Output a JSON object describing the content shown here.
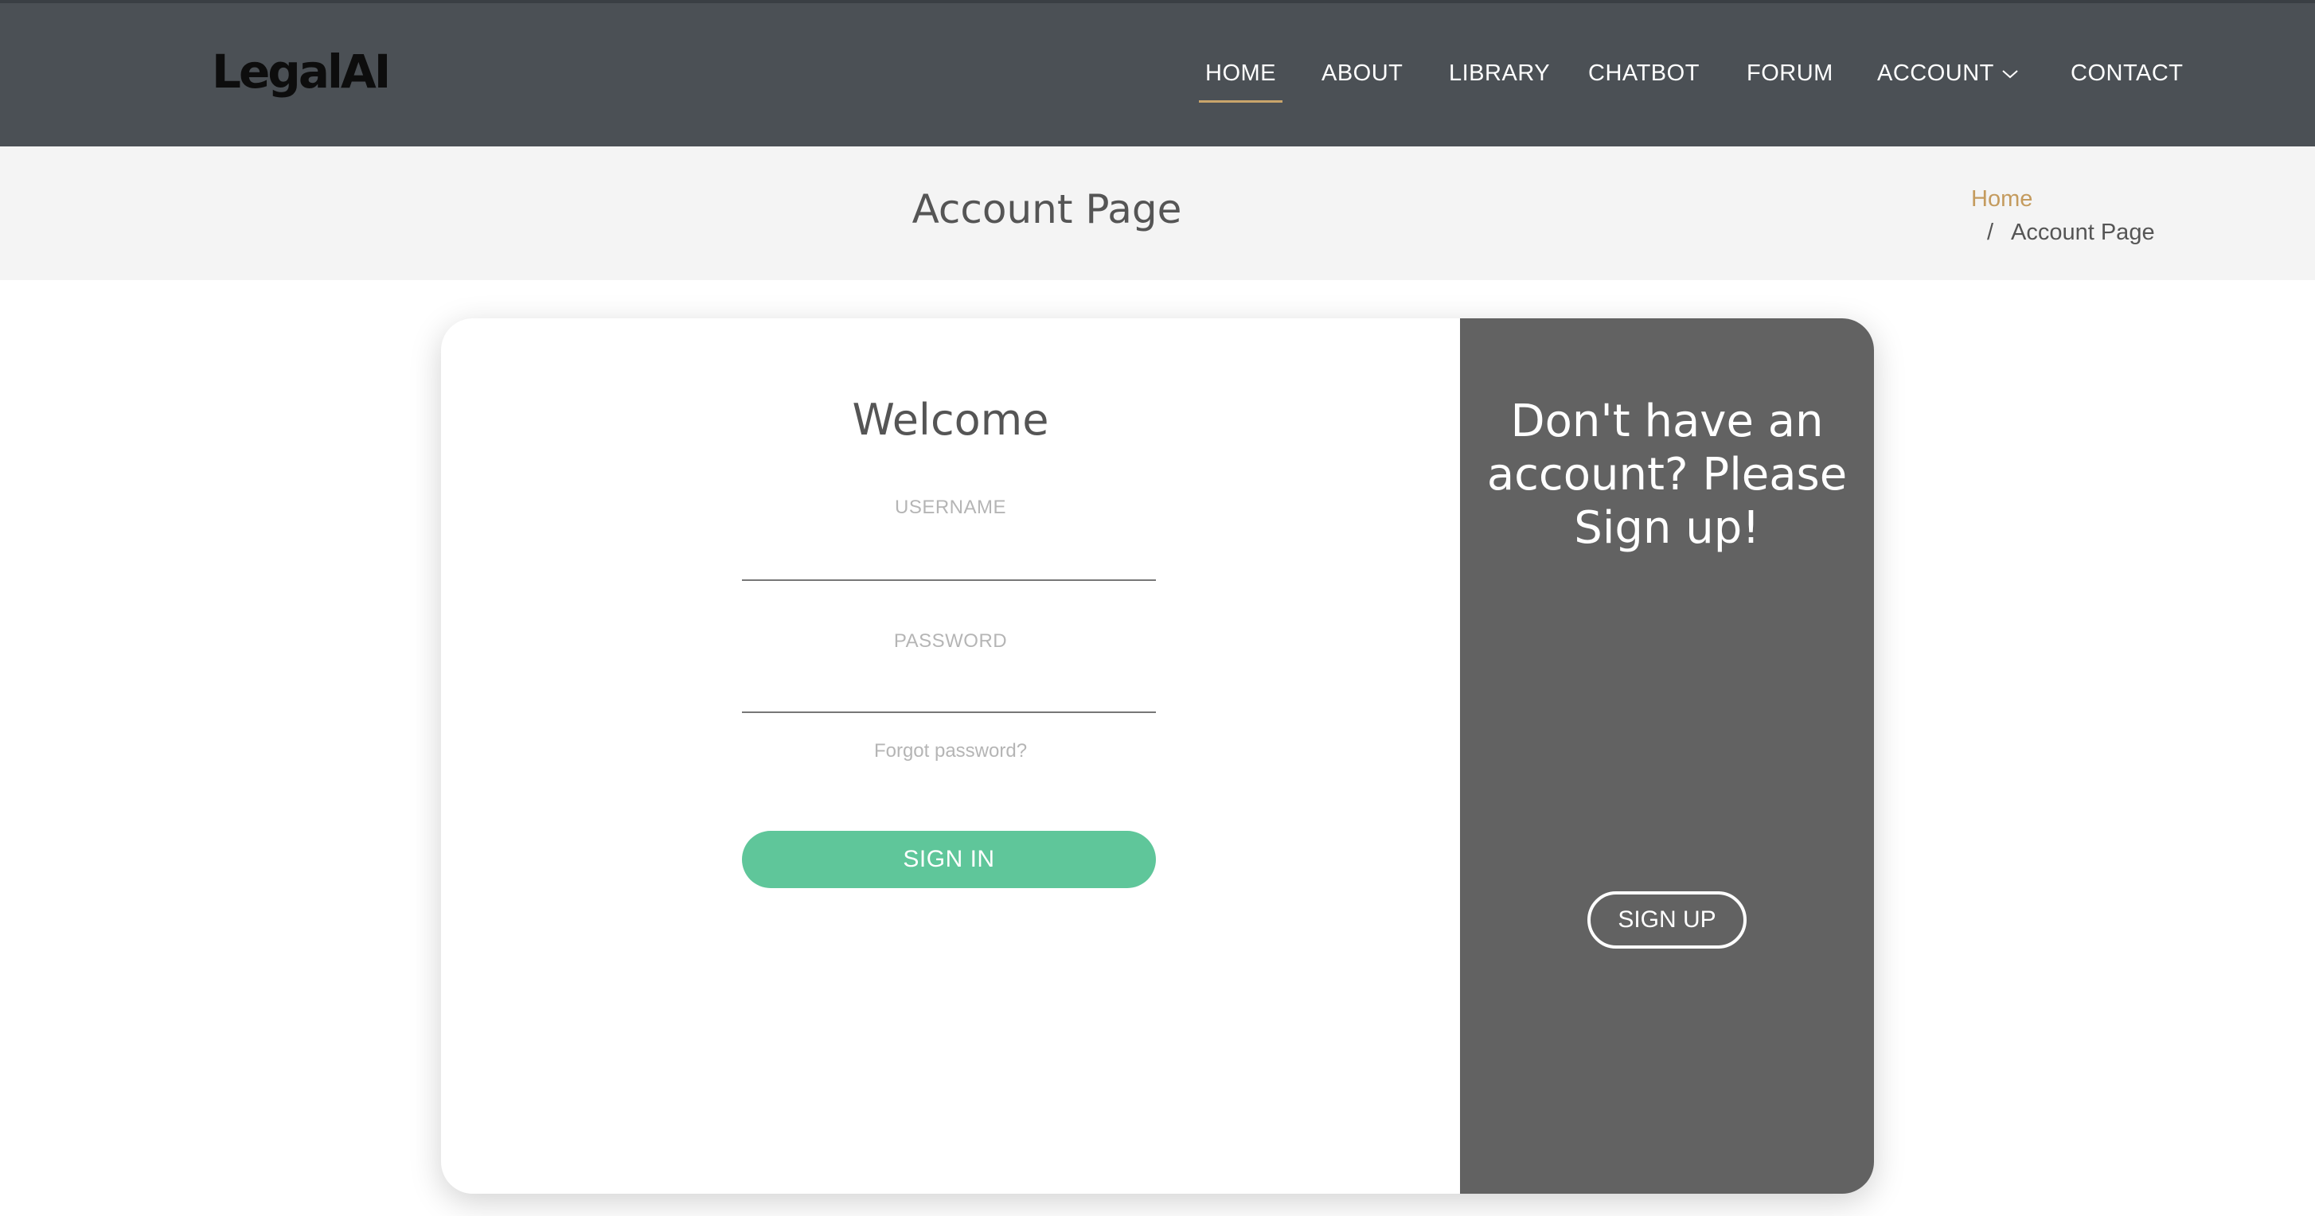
{
  "header": {
    "logo": "LegalAI",
    "nav": [
      {
        "label": "HOME",
        "active": true
      },
      {
        "label": "ABOUT",
        "active": false
      },
      {
        "label": "LIBRARY",
        "active": false
      },
      {
        "label": "CHATBOT",
        "active": false
      },
      {
        "label": "FORUM",
        "active": false
      },
      {
        "label": "ACCOUNT",
        "active": false,
        "icon": "chevron-down-icon"
      },
      {
        "label": "CONTACT",
        "active": false
      }
    ]
  },
  "breadcrumb": {
    "page_title": "Account Page",
    "home": "Home",
    "separator": "/",
    "current": "Account Page"
  },
  "login": {
    "heading": "Welcome",
    "username_label": "USERNAME",
    "username_value": "",
    "password_label": "PASSWORD",
    "password_value": "",
    "forgot": "Forgot password?",
    "submit": "SIGN IN"
  },
  "signup": {
    "heading": "Don't have an account? Please Sign up!",
    "button": "SIGN UP"
  },
  "colors": {
    "header_bg": "#4b5055",
    "accent": "#c9a56b",
    "signin_green": "#5fc69a",
    "panel_gray": "#626262"
  }
}
